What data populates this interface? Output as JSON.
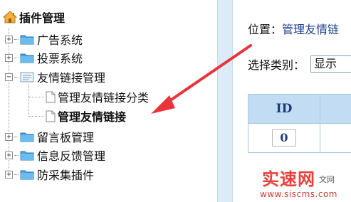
{
  "sidebar": {
    "title": "插件管理",
    "title_icon": "house-icon",
    "items": [
      {
        "label": "广告系统",
        "expander": "+",
        "icon": "folder-icon"
      },
      {
        "label": "投票系统",
        "expander": "+",
        "icon": "folder-icon"
      },
      {
        "label": "友情链接管理",
        "expander": "−",
        "icon": "open-folder-icon",
        "children": [
          {
            "label": "管理友情链接分类",
            "icon": "document-icon"
          },
          {
            "label": "管理友情链接",
            "icon": "document-icon",
            "selected": true
          }
        ]
      },
      {
        "label": "留言板管理",
        "expander": "+",
        "icon": "folder-icon"
      },
      {
        "label": "信息反馈管理",
        "expander": "+",
        "icon": "folder-icon"
      },
      {
        "label": "防采集插件",
        "expander": "+",
        "icon": "folder-icon"
      }
    ]
  },
  "main": {
    "breadcrumb_prefix": "位置：",
    "breadcrumb_link": "管理友情链",
    "filter_label": "选择类别：",
    "filter_value": "显示",
    "table": {
      "headers": [
        "ID"
      ],
      "rows": [
        [
          "0"
        ]
      ]
    }
  },
  "watermark": {
    "brand": "实速网",
    "side": "文网",
    "url": "www.siscms.com"
  },
  "colors": {
    "arrow": "#e8343a",
    "table_header_bg": "#c2dcf3",
    "link": "#1a3f8c",
    "divider_bg": "#dcecf7"
  }
}
